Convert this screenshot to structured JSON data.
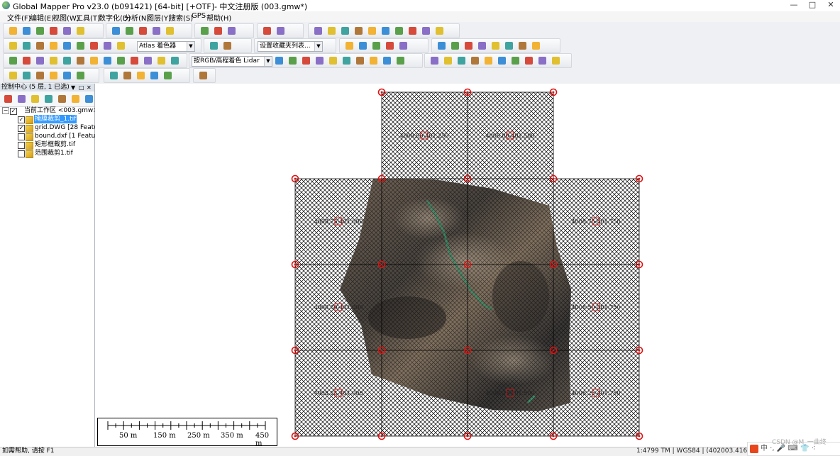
{
  "window": {
    "title": "Global Mapper Pro v23.0 (b091421) [64-bit] [+OTF]- 中文注册版 (003.gmw*)",
    "minimize": "—",
    "maximize": "□",
    "close": "✕"
  },
  "menu": [
    "文件(F)",
    "编辑(E)",
    "视图(W)",
    "工具(T)",
    "数字化(D)",
    "分析(N)",
    "图层(Y)",
    "搜索(S)",
    "GPS",
    "帮助(H)"
  ],
  "toolbar": {
    "shader_combo": "Atlas 着色器",
    "favorites_combo": "设置收藏夹列表...",
    "lidar_combo": "按RGB/高程着色 Lidar"
  },
  "control_center": {
    "title": "控制中心 (5 层, 1 已选)",
    "pin": "▼",
    "restore": "□",
    "close": "✕",
    "workspace": "当前工作区 <003.gmw>",
    "layers": [
      {
        "name": "掩膜裁剪_1.tif",
        "checked": true,
        "selected": true
      },
      {
        "name": "grid.DWG [28 Features]",
        "checked": true,
        "selected": false
      },
      {
        "name": "bound.dxf [1 Features]",
        "checked": false,
        "selected": false
      },
      {
        "name": "矩形框裁剪.tif",
        "checked": false,
        "selected": false
      },
      {
        "name": "范围裁剪1.tif",
        "checked": false,
        "selected": false
      }
    ]
  },
  "grid_labels": {
    "top_row": [
      "4008.00-401.250",
      "4008.00-401.500"
    ],
    "row1": [
      "4008.75-401.000",
      "",
      "",
      "4008.75-401.750"
    ],
    "row2": [
      "4008.50-401.000",
      "",
      "",
      "4008.50-401.750"
    ],
    "row3": [
      "4008.25-401.000",
      "",
      "4008.25-401.500",
      "4008.25-401.750"
    ]
  },
  "scale": {
    "labels": [
      "50 m",
      "150 m",
      "250 m",
      "350 m",
      "450 m"
    ]
  },
  "status": {
    "help": "如需帮助, 请按 F1",
    "info": "1:4799  TM | WGS84 | (402003.416, 4009268.652)"
  },
  "ime": {
    "text": "中 ·, 🎤 ⌨ 👕 ⁖",
    "watermark": "CSDN @M_一曲终"
  },
  "colors": {
    "accent_select": "#3399ff",
    "grid_node": "#e01010",
    "imagery_dark": "#4a4138"
  }
}
